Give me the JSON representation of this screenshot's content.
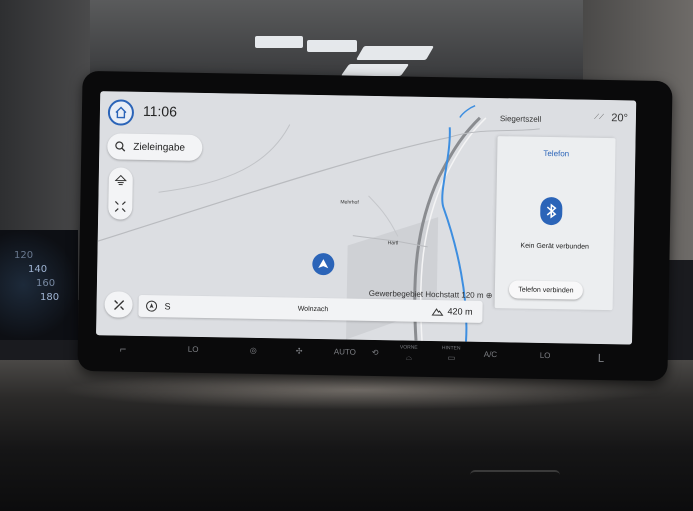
{
  "header": {
    "time": "11:06"
  },
  "search": {
    "label": "Zieleingabe"
  },
  "map": {
    "place_labels": [
      "Mehrhof",
      "Hartl"
    ],
    "poi_text": "Gewerbegebiet Hochstatt",
    "poi_distance": "120 m",
    "top_place": "Siegertszell"
  },
  "status": {
    "temperature": "20°"
  },
  "navbar": {
    "heading": "S",
    "street": "Wolnzach",
    "distance": "420 m"
  },
  "phone": {
    "title": "Telefon",
    "status_text": "Kein Gerät verbunden",
    "connect_label": "Telefon verbinden"
  },
  "climate": {
    "left_temp": "LO",
    "right_temp": "LO",
    "auto_label": "AUTO",
    "front_label": "VORNE",
    "rear_label": "HINTEN",
    "ac_label": "A/C"
  },
  "instrument_cluster": {
    "ticks": [
      "120",
      "140",
      "160",
      "180"
    ]
  },
  "colors": {
    "accent": "#2b64b8",
    "map_bg": "#dcdee2",
    "river": "#3d8ee0"
  }
}
